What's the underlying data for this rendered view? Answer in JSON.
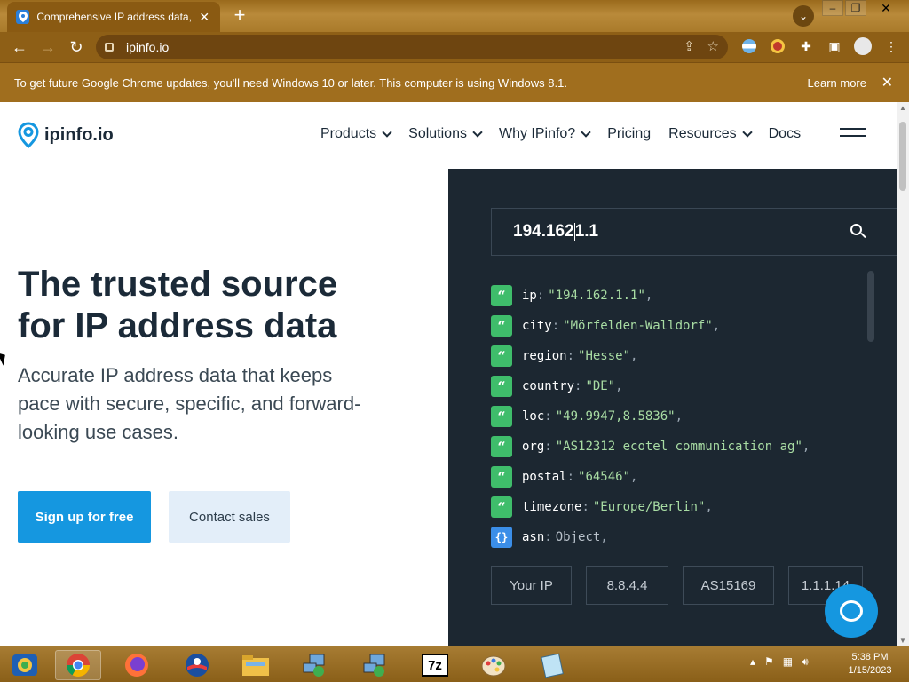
{
  "browser": {
    "tab_title": "Comprehensive IP address data, I…",
    "url": "ipinfo.io",
    "new_tab_symbol": "+",
    "infobar_text": "To get future Google Chrome updates, you'll need Windows 10 or later. This computer is using Windows 8.1.",
    "infobar_link": "Learn more"
  },
  "site": {
    "logo_text": "ipinfo.io",
    "nav": [
      {
        "label": "Products",
        "has_menu": true
      },
      {
        "label": "Solutions",
        "has_menu": true
      },
      {
        "label": "Why IPinfo?",
        "has_menu": true
      },
      {
        "label": "Pricing",
        "has_menu": false
      },
      {
        "label": "Resources",
        "has_menu": true
      },
      {
        "label": "Docs",
        "has_menu": false
      }
    ],
    "hero_title": "The trusted source for IP address data",
    "hero_subtitle": "Accurate IP address data that keeps pace with secure, specific, and forward-looking use cases.",
    "primary_button": "Sign up for free",
    "secondary_button": "Contact sales"
  },
  "demo": {
    "search_value_before_caret": "194.162",
    "search_value_after_caret": "1.1",
    "rows": [
      {
        "badge": "“",
        "key": "ip",
        "value": "\"194.162.1.1\"",
        "type": "string"
      },
      {
        "badge": "“",
        "key": "city",
        "value": "\"Mörfelden-Walldorf\"",
        "type": "string"
      },
      {
        "badge": "“",
        "key": "region",
        "value": "\"Hesse\"",
        "type": "string"
      },
      {
        "badge": "“",
        "key": "country",
        "value": "\"DE\"",
        "type": "string"
      },
      {
        "badge": "“",
        "key": "loc",
        "value": "\"49.9947,8.5836\"",
        "type": "string"
      },
      {
        "badge": "“",
        "key": "org",
        "value": "\"AS12312 ecotel communication ag\"",
        "type": "string"
      },
      {
        "badge": "“",
        "key": "postal",
        "value": "\"64546\"",
        "type": "string"
      },
      {
        "badge": "“",
        "key": "timezone",
        "value": "\"Europe/Berlin\"",
        "type": "string"
      },
      {
        "badge": "{}",
        "key": "asn",
        "value": "Object",
        "type": "object"
      }
    ],
    "quick_buttons": [
      "Your IP",
      "8.8.4.4",
      "AS15169",
      "1.1.1.14"
    ]
  },
  "taskbar": {
    "time": "5:38 PM",
    "date": "1/15/2023",
    "seven_zip_label": "7z"
  },
  "colors": {
    "accent": "#1597e0",
    "panel_bg": "#1c2731",
    "json_string": "#a8dca3",
    "badge_string": "#3fbd6b",
    "badge_object": "#3b8ee8",
    "chrome_theme": "#8e5f16"
  }
}
